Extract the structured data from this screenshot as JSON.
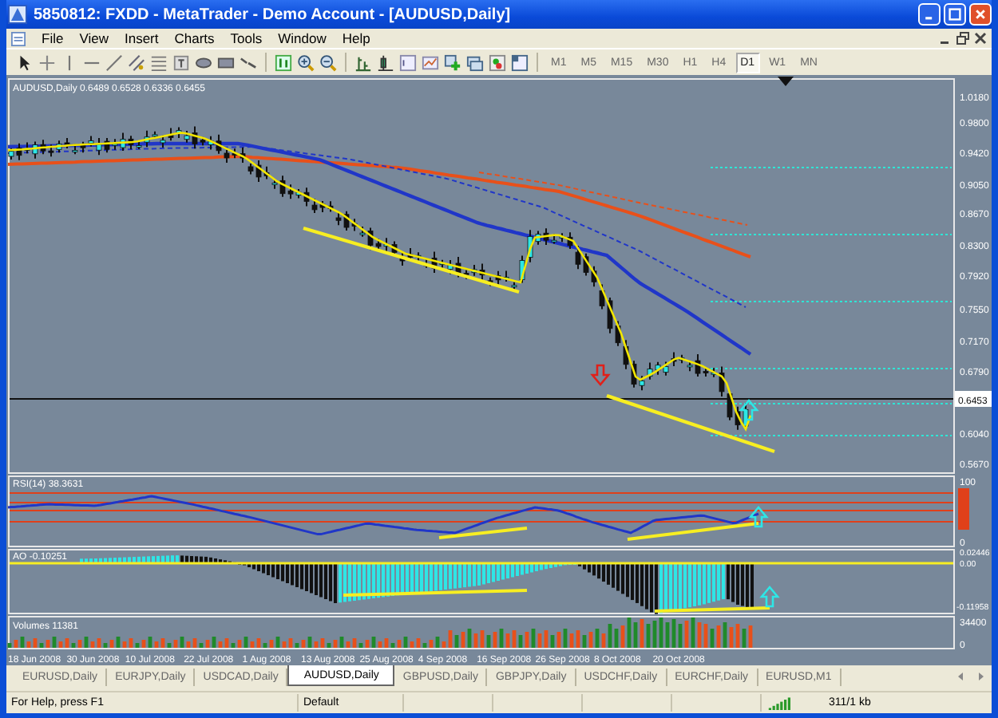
{
  "window": {
    "title": "5850812: FXDD - MetaTrader - Demo Account - [AUDUSD,Daily]"
  },
  "menu": [
    "File",
    "View",
    "Insert",
    "Charts",
    "Tools",
    "Window",
    "Help"
  ],
  "timeframes": [
    {
      "label": "M1",
      "selected": false
    },
    {
      "label": "M5",
      "selected": false
    },
    {
      "label": "M15",
      "selected": false
    },
    {
      "label": "M30",
      "selected": false
    },
    {
      "label": "H1",
      "selected": false
    },
    {
      "label": "H4",
      "selected": false
    },
    {
      "label": "D1",
      "selected": true
    },
    {
      "label": "W1",
      "selected": false
    },
    {
      "label": "MN",
      "selected": false
    }
  ],
  "chart": {
    "legend": "AUDUSD,Daily  0.6489 0.6528 0.6336 0.6455",
    "price_axis": [
      "1.0180",
      "0.9800",
      "0.9420",
      "0.9050",
      "0.8670",
      "0.8300",
      "0.7920",
      "0.7550",
      "0.7170",
      "0.6790",
      "0.6040",
      "0.5670"
    ],
    "current_price": "0.6453",
    "rsi": {
      "legend": "RSI(14) 38.3631",
      "axis": [
        "100",
        "0"
      ]
    },
    "ao": {
      "legend": "AO -0.10251",
      "axis": [
        "0.02446",
        "0.00",
        "-0.11958"
      ]
    },
    "volumes": {
      "legend": "Volumes 11381",
      "axis": [
        "34400",
        "0"
      ]
    },
    "dates": [
      "18 Jun 2008",
      "30 Jun 2008",
      "10 Jul 2008",
      "22 Jul 2008",
      "1 Aug 2008",
      "13 Aug 2008",
      "25 Aug 2008",
      "4 Sep 2008",
      "16 Sep 2008",
      "26 Sep 2008",
      "8 Oct 2008",
      "20 Oct 2008"
    ]
  },
  "tabs": [
    {
      "label": "EURUSD,Daily",
      "selected": false
    },
    {
      "label": "EURJPY,Daily",
      "selected": false
    },
    {
      "label": "USDCAD,Daily",
      "selected": false
    },
    {
      "label": "AUDUSD,Daily",
      "selected": true
    },
    {
      "label": "GBPUSD,Daily",
      "selected": false
    },
    {
      "label": "GBPJPY,Daily",
      "selected": false
    },
    {
      "label": "USDCHF,Daily",
      "selected": false
    },
    {
      "label": "EURCHF,Daily",
      "selected": false
    },
    {
      "label": "EURUSD,M1",
      "selected": false
    }
  ],
  "status_bar": {
    "help": "For Help, press F1",
    "profile": "Default",
    "traffic": "311/1 kb"
  }
}
